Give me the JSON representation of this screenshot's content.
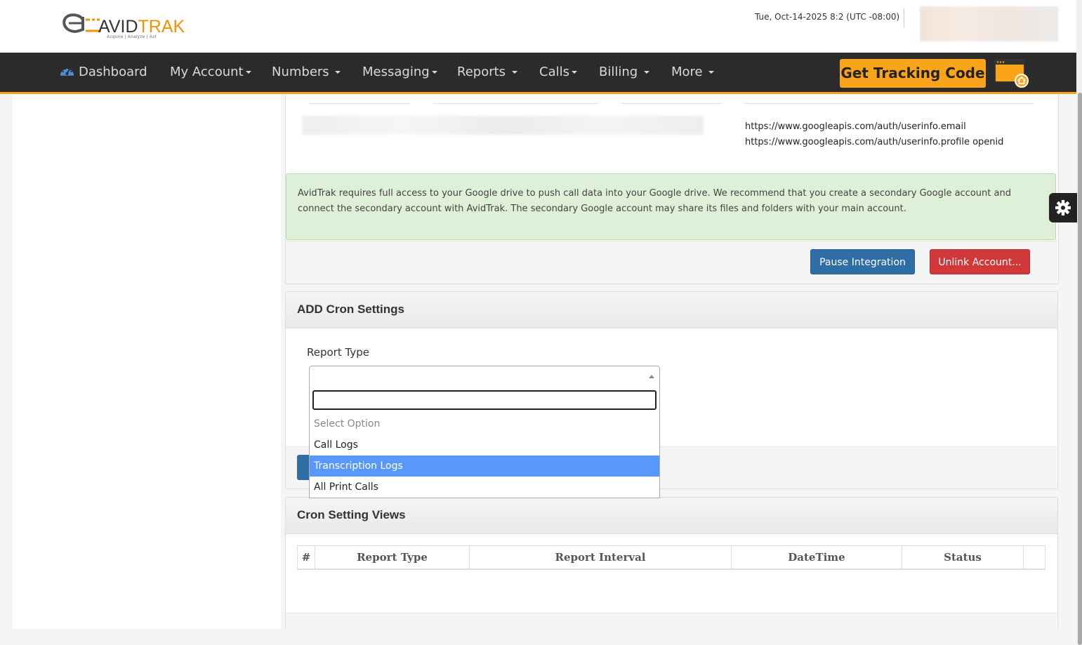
{
  "header": {
    "logo": {
      "word_avid": "AVID",
      "word_trak": "TRAK",
      "tagline": "Acquire  |  Analyze  |  Act"
    },
    "datetime": "Tue, Oct-14-2025 8:2 (UTC -08:00)"
  },
  "nav": {
    "items": [
      {
        "label": "Dashboard"
      },
      {
        "label": "My Account"
      },
      {
        "label": "Numbers"
      },
      {
        "label": "Messaging"
      },
      {
        "label": "Reports"
      },
      {
        "label": "Calls"
      },
      {
        "label": "Billing"
      },
      {
        "label": "More"
      }
    ],
    "tracking_button": "Get Tracking Code"
  },
  "integration": {
    "scopes": [
      "https://www.googleapis.com/auth/userinfo.email",
      "https://www.googleapis.com/auth/userinfo.profile openid"
    ],
    "notice": "AvidTrak requires full access to your Google drive to push call data into your Google drive. We recommend that you create a secondary Google account and connect the secondary account with AvidTrak. The secondary Google account may share its files and folders with your main account.",
    "pause_label": "Pause Integration",
    "unlink_label": "Unlink Account..."
  },
  "cron_settings": {
    "title": "ADD Cron Settings",
    "report_type_label": "Report Type",
    "selected_value": "",
    "search_value": "",
    "options": [
      {
        "label": "Select Option",
        "placeholder": true
      },
      {
        "label": "Call Logs"
      },
      {
        "label": "Transcription Logs",
        "highlighted": true
      },
      {
        "label": "All Print Calls"
      }
    ]
  },
  "cron_views": {
    "title": "Cron Setting Views",
    "columns": [
      "#",
      "Report Type",
      "Report Interval",
      "DateTime",
      "Status",
      ""
    ]
  },
  "colors": {
    "navbar_bg": "#2b2b2b",
    "accent_orange": "#f9a41a",
    "alert_bg": "#dff0d8",
    "btn_blue": "#2f6ea5",
    "btn_red": "#d0383a",
    "option_highlight": "#5897fb"
  },
  "icons": [
    "dashboard-gauge-icon",
    "caret-down-icon",
    "tracking-code-window-icon",
    "home-badge-icon",
    "gear-icon",
    "select-arrow-icon"
  ]
}
